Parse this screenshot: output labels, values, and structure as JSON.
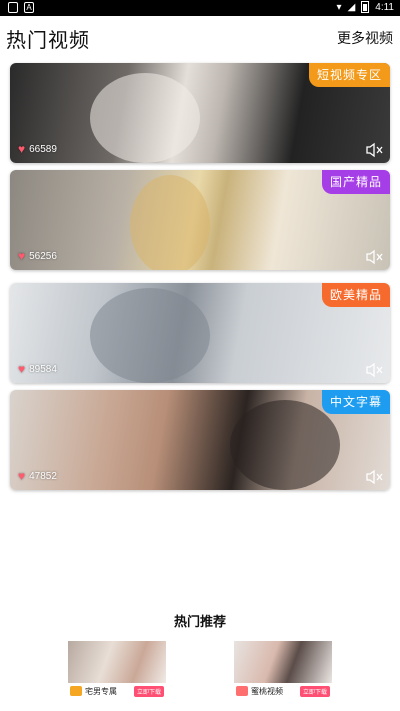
{
  "status": {
    "time": "4:11"
  },
  "header": {
    "title": "热门视频",
    "more": "更多视频"
  },
  "cards": [
    {
      "tag": "短视频专区",
      "tag_color": "#f39a1a",
      "likes": "66589"
    },
    {
      "tag": "国产精品",
      "tag_color": "#a63ee8",
      "likes": "56256"
    },
    {
      "tag": "欧美精品",
      "tag_color": "#f66a2d",
      "likes": "89584"
    },
    {
      "tag": "中文字幕",
      "tag_color": "#1e9df0",
      "likes": "47852"
    }
  ],
  "recommend": {
    "title": "热门推荐",
    "apps": [
      {
        "name": "宅男专属",
        "button": "立即下载",
        "logo_color": "#f5a623"
      },
      {
        "name": "蜜桃视频",
        "button": "立即下载",
        "logo_color": "#ff6f6f"
      }
    ]
  },
  "icons": {
    "like": "heart-icon",
    "mute": "mute-icon"
  }
}
